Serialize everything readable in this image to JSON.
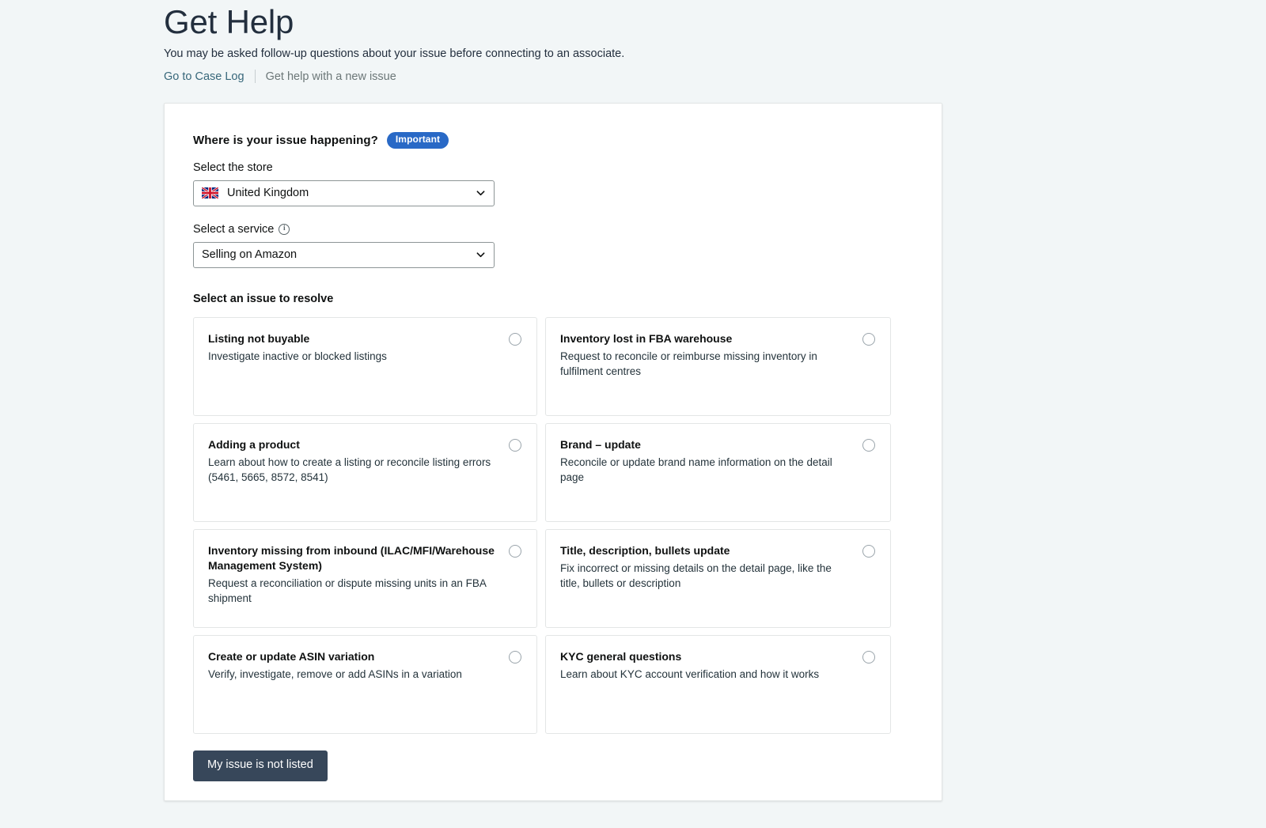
{
  "header": {
    "title": "Get Help",
    "subtitle": "You may be asked follow-up questions about your issue before connecting to an associate.",
    "case_log_link": "Go to Case Log",
    "new_issue_link": "Get help with a new issue"
  },
  "form": {
    "section_title": "Where is your issue happening?",
    "badge": "Important",
    "store_label": "Select the store",
    "store_value": "United Kingdom",
    "store_flag": "uk-flag-icon",
    "service_label": "Select a service",
    "service_info_icon": "info-icon",
    "service_value": "Selling on Amazon",
    "chevron_icon": "chevron-down-icon"
  },
  "issues": {
    "heading": "Select an issue to resolve",
    "cards": [
      {
        "title": "Listing not buyable",
        "desc": "Investigate inactive or blocked listings"
      },
      {
        "title": "Inventory lost in FBA warehouse",
        "desc": "Request to reconcile or reimburse missing inventory in fulfilment centres"
      },
      {
        "title": "Adding a product",
        "desc": "Learn about how to create a listing or reconcile listing errors (5461, 5665, 8572, 8541)"
      },
      {
        "title": "Brand – update",
        "desc": "Reconcile or update brand name information on the detail page"
      },
      {
        "title": "Inventory missing from inbound (ILAC/MFI/Warehouse Management System)",
        "desc": "Request a reconciliation or dispute missing units in an FBA shipment"
      },
      {
        "title": "Title, description, bullets update",
        "desc": "Fix incorrect or missing details on the detail page, like the title, bullets or description"
      },
      {
        "title": "Create or update ASIN variation",
        "desc": "Verify, investigate, remove or add ASINs in a variation"
      },
      {
        "title": "KYC general questions",
        "desc": "Learn about KYC account verification and how it works"
      }
    ]
  },
  "footer": {
    "not_listed_button": "My issue is not listed"
  },
  "colors": {
    "page_background": "#f2f6f7",
    "badge_blue": "#2969c6",
    "link_teal": "#37677a",
    "button_slate": "#37475a",
    "title_navy": "#232f3e"
  }
}
